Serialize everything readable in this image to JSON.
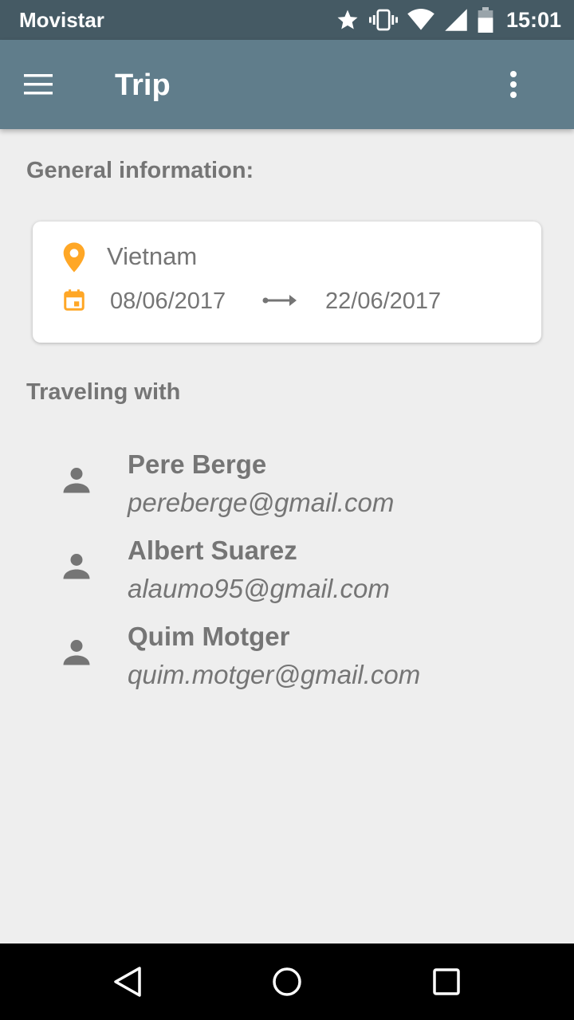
{
  "status_bar": {
    "carrier": "Movistar",
    "time": "15:01",
    "icons": [
      "star-icon",
      "vibrate-icon",
      "wifi-icon",
      "signal-icon",
      "battery-icon"
    ]
  },
  "app_bar": {
    "title": "Trip",
    "icons": [
      "menu-icon",
      "more-vert-icon"
    ]
  },
  "general": {
    "heading": "General information:",
    "location": "Vietnam",
    "start_date": "08/06/2017",
    "end_date": "22/06/2017",
    "icons": [
      "location-pin-icon",
      "calendar-icon",
      "arrow-right-icon"
    ]
  },
  "traveling": {
    "heading": "Traveling with",
    "people": [
      {
        "name": "Pere Berge",
        "email": "pereberge@gmail.com"
      },
      {
        "name": "Albert Suarez",
        "email": "alaumo95@gmail.com"
      },
      {
        "name": "Quim Motger",
        "email": "quim.motger@gmail.com"
      }
    ]
  },
  "nav_bar": {
    "icons": [
      "back-icon",
      "home-icon",
      "recents-icon"
    ]
  },
  "colors": {
    "status_bar": "#455A64",
    "app_bar": "#607D8B",
    "accent": "#FFA726",
    "text_secondary": "#757575",
    "background": "#EEEEEE"
  }
}
